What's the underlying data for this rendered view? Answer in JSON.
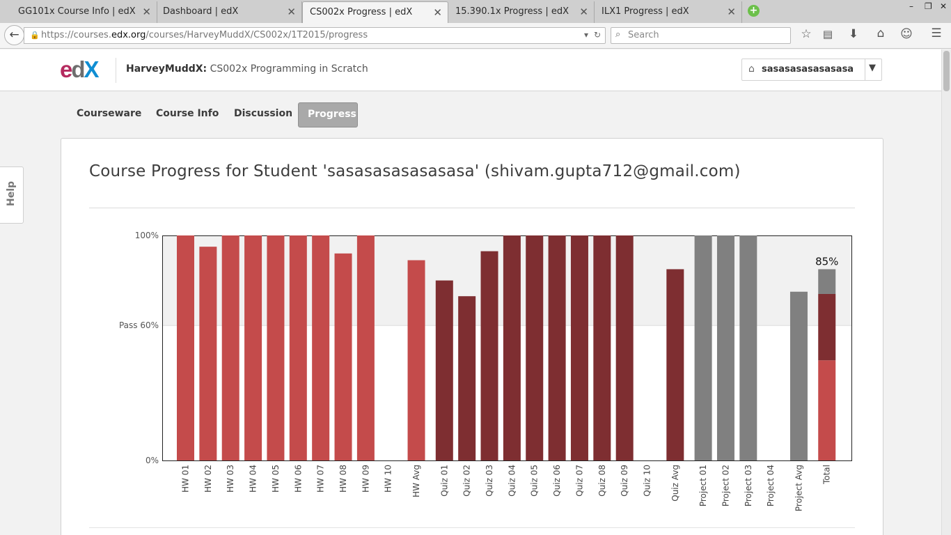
{
  "browser": {
    "tabs": [
      {
        "label": "GG101x Course Info | edX",
        "active": false
      },
      {
        "label": "Dashboard | edX",
        "active": false
      },
      {
        "label": "CS002x Progress | edX",
        "active": true
      },
      {
        "label": "15.390.1x Progress | edX",
        "active": false
      },
      {
        "label": "ILX1 Progress | edX",
        "active": false
      }
    ],
    "url_prefix": "https://courses.",
    "url_host": "edx.org",
    "url_path": "/courses/HarveyMuddX/CS002x/1T2015/progress",
    "search_placeholder": "Search"
  },
  "header": {
    "logo": {
      "e": "e",
      "d": "d",
      "x": "X"
    },
    "org": "HarveyMuddX:",
    "course": "CS002x Programming in Scratch",
    "username": "sasasasasasasasa"
  },
  "course_nav": [
    "Courseware",
    "Course Info",
    "Discussion",
    "Progress"
  ],
  "active_nav": "Progress",
  "help_label": "Help",
  "progress": {
    "title": "Course Progress for Student 'sasasasasasasasa' (shivam.gupta712@gmail.com)"
  },
  "colors": {
    "homework": "#c44b4b",
    "quiz": "#7e2e31",
    "project": "#808080",
    "pass_band": "#f1f1f1",
    "active_tab": "#a9a9a9"
  },
  "chart_data": {
    "type": "bar",
    "y_ticks": [
      {
        "label": "100%",
        "value": 100
      },
      {
        "label": "Pass 60%",
        "value": 60
      },
      {
        "label": "0%",
        "value": 0
      }
    ],
    "ylim": [
      0,
      100
    ],
    "pass_threshold": 60,
    "total_label": "85%",
    "bars": [
      {
        "label": "HW 01",
        "value": 100,
        "group": "homework"
      },
      {
        "label": "HW 02",
        "value": 95,
        "group": "homework"
      },
      {
        "label": "HW 03",
        "value": 100,
        "group": "homework"
      },
      {
        "label": "HW 04",
        "value": 100,
        "group": "homework"
      },
      {
        "label": "HW 05",
        "value": 100,
        "group": "homework"
      },
      {
        "label": "HW 06",
        "value": 100,
        "group": "homework"
      },
      {
        "label": "HW 07",
        "value": 100,
        "group": "homework"
      },
      {
        "label": "HW 08",
        "value": 92,
        "group": "homework"
      },
      {
        "label": "HW 09",
        "value": 100,
        "group": "homework"
      },
      {
        "label": "HW 10",
        "value": 0,
        "group": "homework"
      },
      {
        "label": "HW Avg",
        "value": 89,
        "group": "homework",
        "gap_before": true
      },
      {
        "label": "Quiz 01",
        "value": 80,
        "group": "quiz",
        "gap_before": true
      },
      {
        "label": "Quiz 02",
        "value": 73,
        "group": "quiz"
      },
      {
        "label": "Quiz 03",
        "value": 93,
        "group": "quiz"
      },
      {
        "label": "Quiz 04",
        "value": 100,
        "group": "quiz"
      },
      {
        "label": "Quiz 05",
        "value": 100,
        "group": "quiz"
      },
      {
        "label": "Quiz 06",
        "value": 100,
        "group": "quiz"
      },
      {
        "label": "Quiz 07",
        "value": 100,
        "group": "quiz"
      },
      {
        "label": "Quiz 08",
        "value": 100,
        "group": "quiz"
      },
      {
        "label": "Quiz 09",
        "value": 100,
        "group": "quiz"
      },
      {
        "label": "Quiz 10",
        "value": 0,
        "group": "quiz"
      },
      {
        "label": "Quiz Avg",
        "value": 85,
        "group": "quiz",
        "gap_before": true
      },
      {
        "label": "Project 01",
        "value": 100,
        "group": "project",
        "gap_before": true
      },
      {
        "label": "Project 02",
        "value": 100,
        "group": "project"
      },
      {
        "label": "Project 03",
        "value": 100,
        "group": "project"
      },
      {
        "label": "Project 04",
        "value": 0,
        "group": "project"
      },
      {
        "label": "Project Avg",
        "value": 75,
        "group": "project",
        "gap_before": true
      },
      {
        "label": "Total",
        "group": "total",
        "gap_before": true,
        "segments": [
          {
            "group": "homework",
            "value": 44.5
          },
          {
            "group": "quiz",
            "value": 29.5
          },
          {
            "group": "project",
            "value": 11
          }
        ]
      }
    ]
  }
}
